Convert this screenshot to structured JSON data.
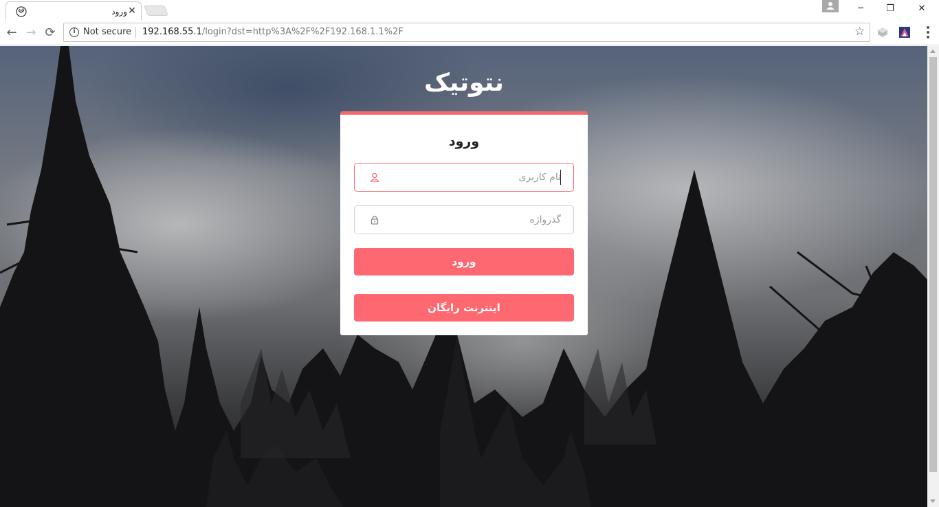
{
  "browser": {
    "tab_title": "ورود",
    "tab_close": "✕",
    "security_label": "Not secure",
    "url_host": "192.168.55.1",
    "url_path": "/login?dst=http%3A%2F%2F192.168.1.1%2F",
    "back_glyph": "←",
    "forward_glyph": "→",
    "reload_glyph": "⟳",
    "star_glyph": "☆",
    "info_glyph": "i",
    "minimize_glyph": "─",
    "restore_glyph": "❐",
    "close_glyph": "✕"
  },
  "page": {
    "brand": "نتوتیک",
    "login": {
      "title": "ورود",
      "username_placeholder": "نام کاربری",
      "password_placeholder": "گذرواژه",
      "submit_label": "ورود",
      "free_internet_label": "اینترنت رایگان"
    }
  },
  "colors": {
    "accent": "#f26a6f",
    "button": "#fd6871"
  },
  "icons": {
    "username": "user-icon",
    "password": "lock-icon"
  }
}
